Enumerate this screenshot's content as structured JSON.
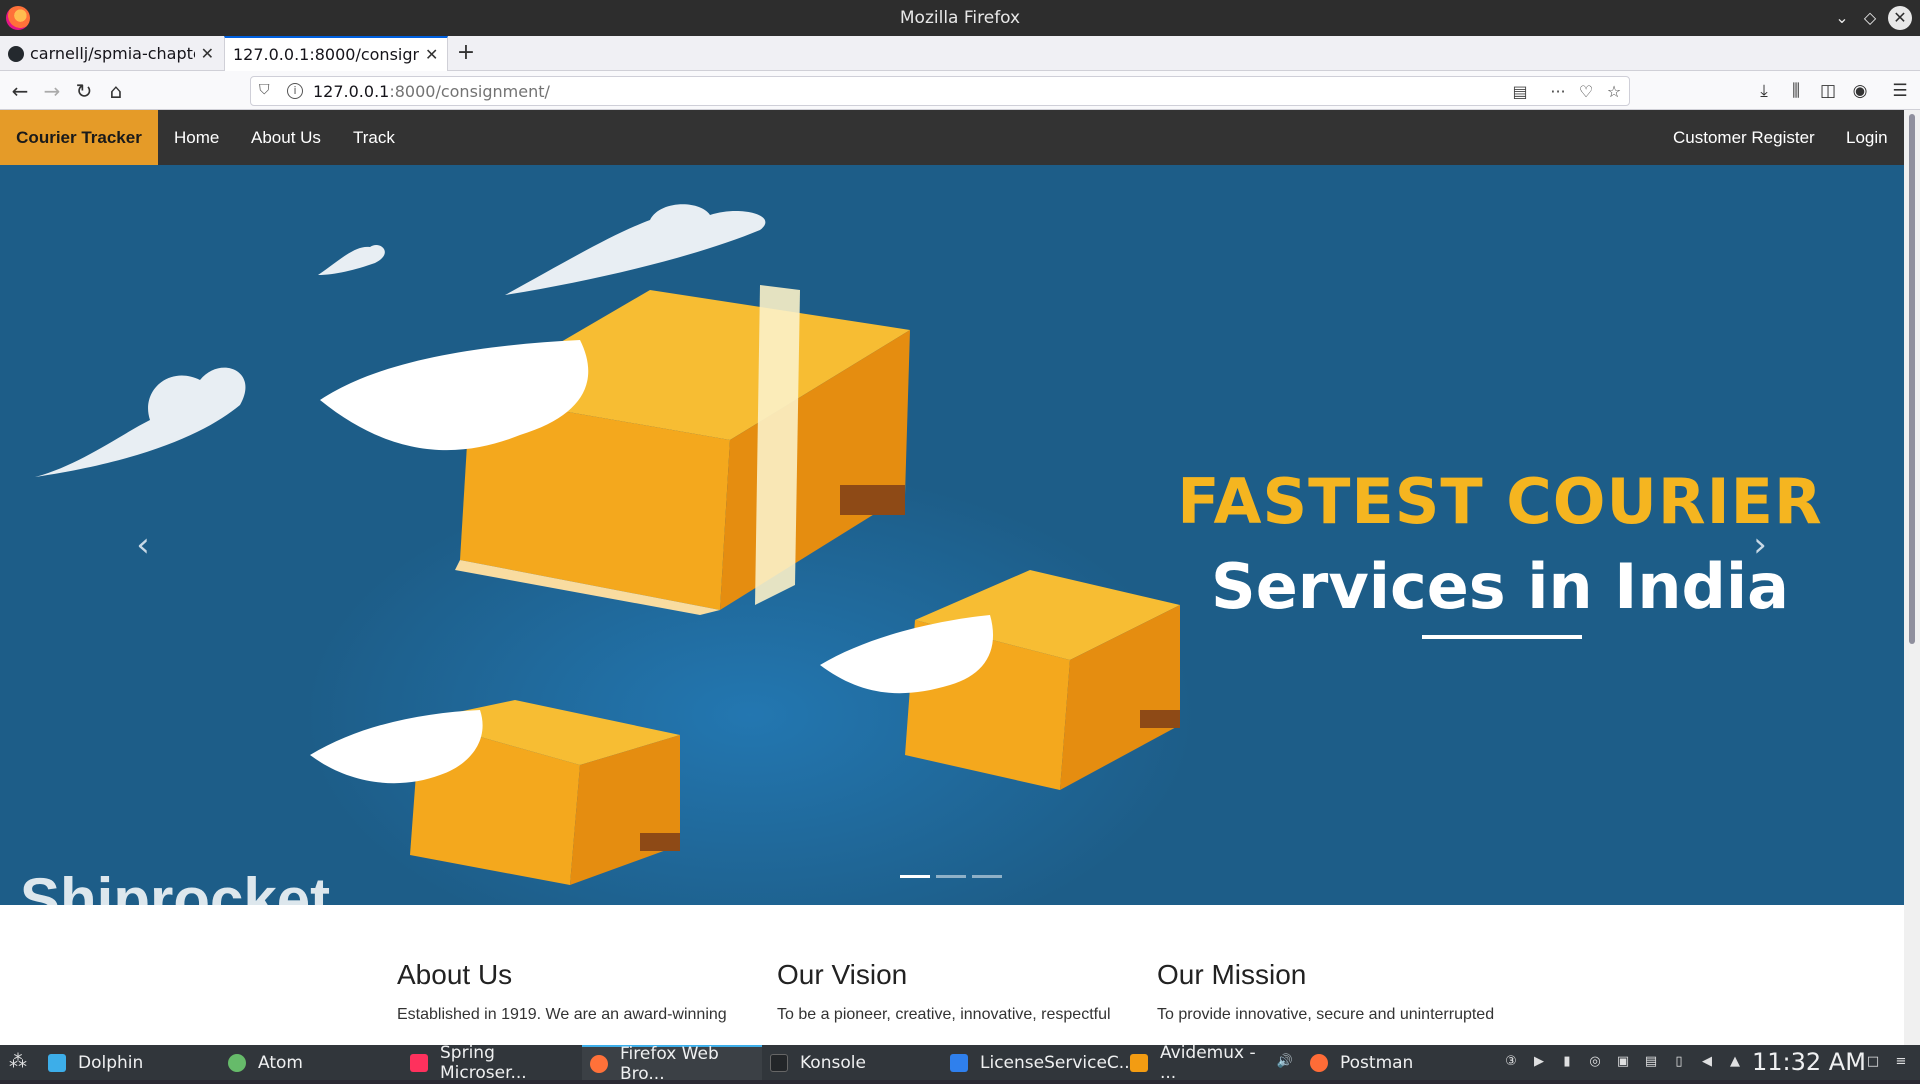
{
  "window": {
    "title": "Mozilla Firefox"
  },
  "tabs": [
    {
      "label": "carnellj/spmia-chapte",
      "active": false
    },
    {
      "label": "127.0.0.1:8000/consignm",
      "active": true
    }
  ],
  "urlbar": {
    "host": "127.0.0.1",
    "rest": ":8000/consignment/"
  },
  "site": {
    "brand": "Courier Tracker",
    "nav_left": [
      "Home",
      "About Us",
      "Track"
    ],
    "nav_right": [
      "Customer Register",
      "Login"
    ]
  },
  "hero": {
    "heading": "FASTEST COURIER",
    "subheading": "Services in India",
    "prev_arrow": "‹",
    "next_arrow": "›",
    "slides_total": 3,
    "slide_active": 1
  },
  "sections": [
    {
      "title": "About Us",
      "text": "Established in 1919. We are an award-winning"
    },
    {
      "title": "Our Vision",
      "text": "To be a pioneer, creative, innovative, respectful"
    },
    {
      "title": "Our Mission",
      "text": "To provide innovative, secure and uninterrupted"
    }
  ],
  "taskbar": {
    "tasks": [
      {
        "label": "Dolphin",
        "icon": "dolphin-icon",
        "color": "#3daee9"
      },
      {
        "label": "Atom",
        "icon": "atom-icon",
        "color": "#66bb6a"
      },
      {
        "label": "Spring Microser...",
        "icon": "intellij-icon",
        "color": "#fe315d"
      },
      {
        "label": "Firefox Web Bro...",
        "icon": "firefox-icon",
        "color": "#ff7139"
      },
      {
        "label": "Konsole",
        "icon": "konsole-icon",
        "color": "#232629"
      },
      {
        "label": "LicenseServiceC...",
        "icon": "vscode-icon",
        "color": "#2f80ed"
      },
      {
        "label": "Avidemux - ...",
        "icon": "avidemux-icon",
        "color": "#f39c12"
      },
      {
        "label": "Postman",
        "icon": "postman-icon",
        "color": "#ff6c37"
      }
    ],
    "clock": "11:32 AM"
  }
}
